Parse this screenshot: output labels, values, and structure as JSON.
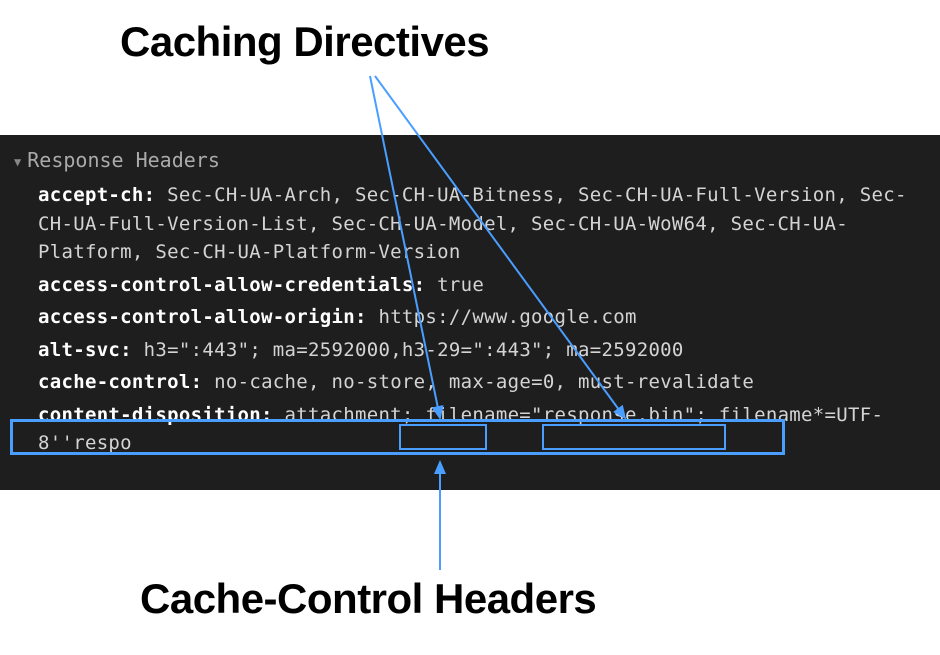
{
  "annotations": {
    "top_label": "Caching Directives",
    "bottom_label": "Cache-Control Headers"
  },
  "devtools": {
    "section_title": "Response Headers",
    "headers": {
      "accept_ch": {
        "name": "accept-ch:",
        "value": "Sec-CH-UA-Arch, Sec-CH-UA-Bitness, Sec-CH-UA-Full-Version, Sec-CH-UA-Full-Version-List, Sec-CH-UA-Model, Sec-CH-UA-WoW64, Sec-CH-UA-Platform, Sec-CH-UA-Platform-Version"
      },
      "ac_allow_credentials": {
        "name": "access-control-allow-credentials:",
        "value": "true"
      },
      "ac_allow_origin": {
        "name": "access-control-allow-origin:",
        "value": "https://www.google.com"
      },
      "alt_svc": {
        "name": "alt-svc:",
        "value": "h3=\":443\"; ma=2592000,h3-29=\":443\"; ma=2592000"
      },
      "cache_control": {
        "name": "cache-control:",
        "prefix": "no-cache, no-store, ",
        "directive1": "max-age",
        "mid1": "=0, ",
        "directive2": "must-revalidate"
      },
      "content_disposition": {
        "name": "content-disposition:",
        "value": "attachment; filename=\"response.bin\"; filename*=UTF-8''respo"
      }
    }
  }
}
